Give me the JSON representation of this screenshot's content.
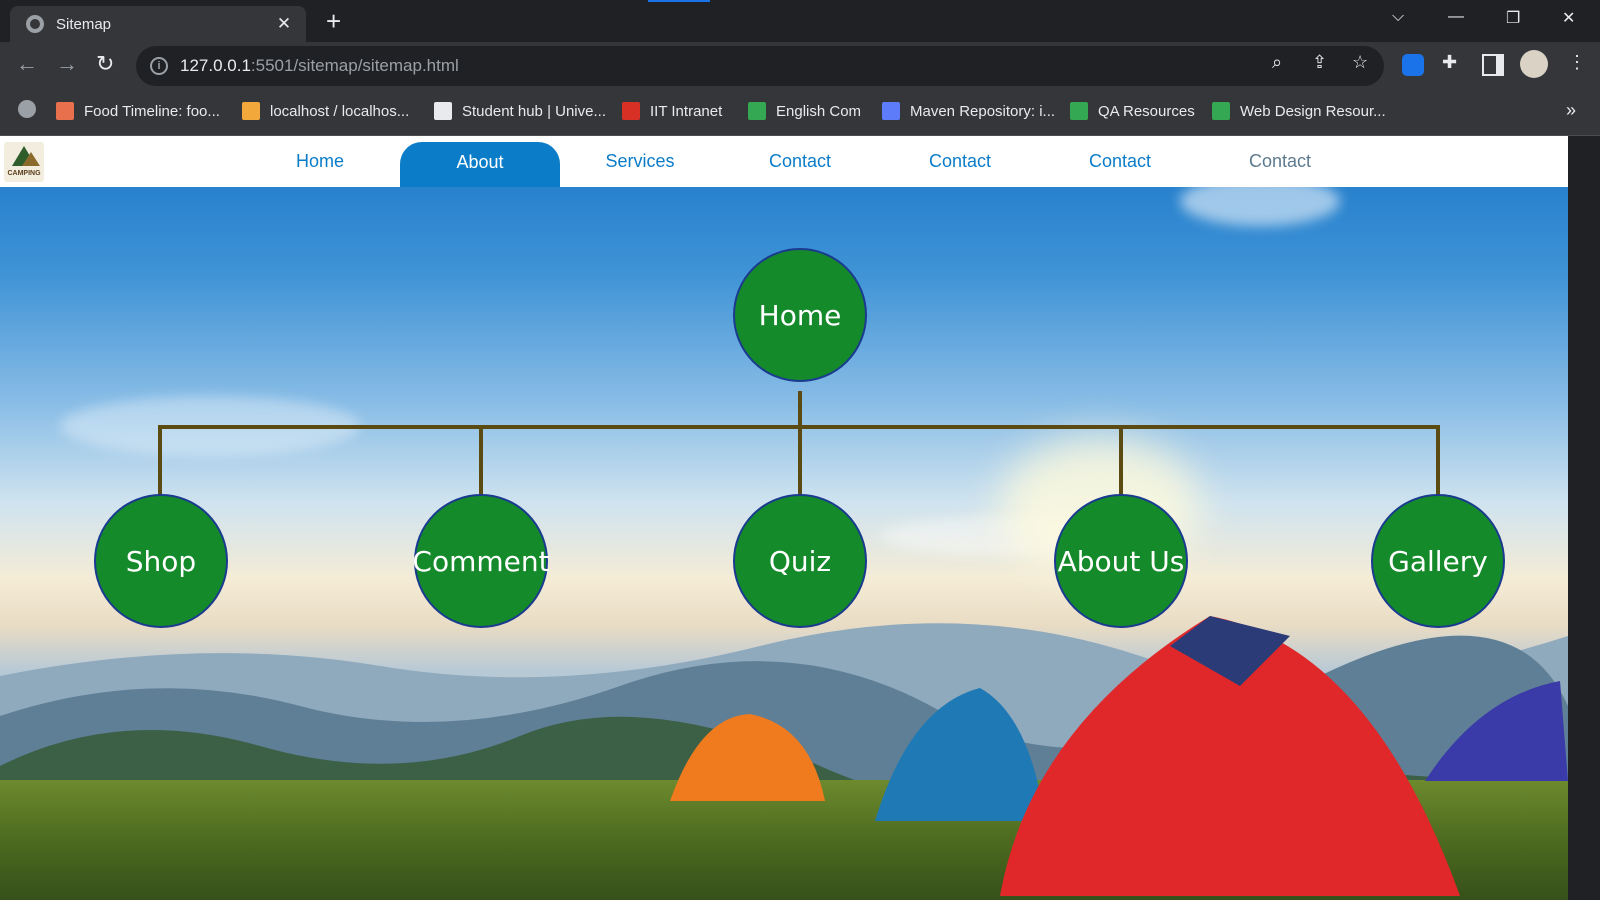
{
  "browser": {
    "tab_title": "Sitemap",
    "url_host": "127.0.0.1",
    "url_path": ":5501/sitemap/sitemap.html",
    "bookmarks": [
      {
        "label": "Food Timeline: foo...",
        "icon": "ft-icon",
        "color": "#e8704c"
      },
      {
        "label": "localhost / localhos...",
        "icon": "pma-icon",
        "color": "#f2a83b"
      },
      {
        "label": "Student hub | Unive...",
        "icon": "building-icon",
        "color": "#e8eaed"
      },
      {
        "label": "IIT Intranet",
        "icon": "shield-icon",
        "color": "#d93025"
      },
      {
        "label": "English Com",
        "icon": "drive-icon",
        "color": "#34a853"
      },
      {
        "label": "Maven Repository: i...",
        "icon": "mvn-icon",
        "color": "#5c7cfa"
      },
      {
        "label": "QA Resources",
        "icon": "drive-icon",
        "color": "#34a853"
      },
      {
        "label": "Web Design Resour...",
        "icon": "drive-icon",
        "color": "#34a853"
      }
    ],
    "more_label": "»"
  },
  "site": {
    "logo_text": "CAMPING",
    "nav": [
      {
        "label": "Home",
        "active": false
      },
      {
        "label": "About",
        "active": true
      },
      {
        "label": "Services",
        "active": false
      },
      {
        "label": "Contact",
        "active": false
      },
      {
        "label": "Contact",
        "active": false
      },
      {
        "label": "Contact",
        "active": false
      },
      {
        "label": "Contact",
        "active": false
      }
    ]
  },
  "sitemap": {
    "root": "Home",
    "children": [
      "Shop",
      "Comment",
      "Quiz",
      "About Us",
      "Gallery"
    ]
  },
  "colors": {
    "node_fill": "#148a2a",
    "node_border": "#1a3b8f",
    "connector": "#5b4a12",
    "nav_accent": "#0b7cc8"
  }
}
